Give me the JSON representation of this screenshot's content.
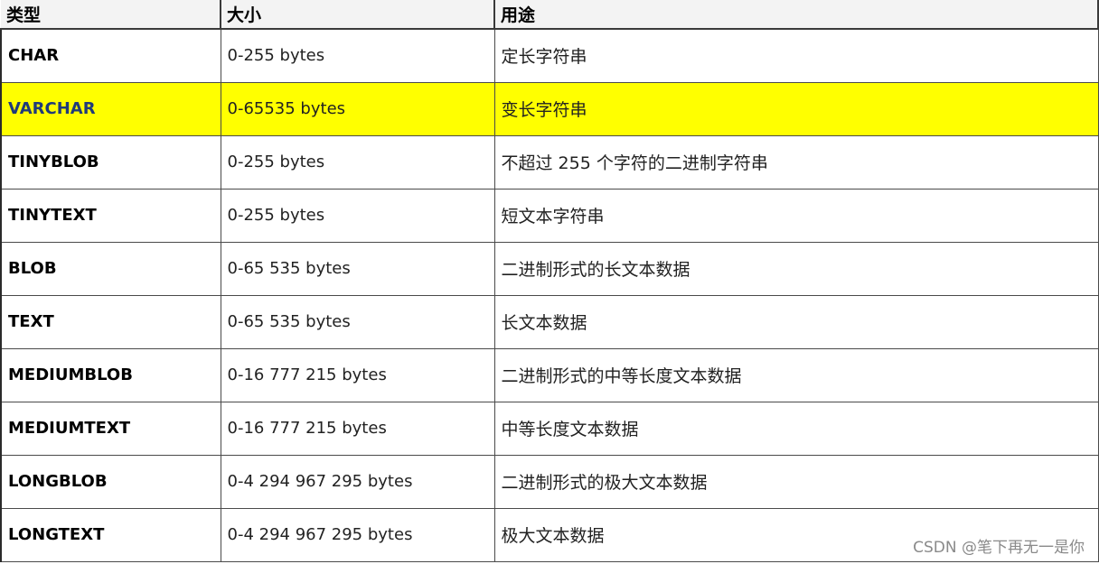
{
  "header": {
    "col_type": "类型",
    "col_size": "大小",
    "col_use": "用途"
  },
  "rows": [
    {
      "type": "CHAR",
      "size": "0-255 bytes",
      "use": "定长字符串"
    },
    {
      "type": "VARCHAR",
      "size": "0-65535 bytes",
      "use": "变长字符串"
    },
    {
      "type": "TINYBLOB",
      "size": "0-255 bytes",
      "use": "不超过 255 个字符的二进制字符串"
    },
    {
      "type": "TINYTEXT",
      "size": "0-255 bytes",
      "use": "短文本字符串"
    },
    {
      "type": "BLOB",
      "size": "0-65 535 bytes",
      "use": "二进制形式的长文本数据"
    },
    {
      "type": "TEXT",
      "size": "0-65 535 bytes",
      "use": "长文本数据"
    },
    {
      "type": "MEDIUMBLOB",
      "size": "0-16 777 215 bytes",
      "use": "二进制形式的中等长度文本数据"
    },
    {
      "type": "MEDIUMTEXT",
      "size": "0-16 777 215 bytes",
      "use": "中等长度文本数据"
    },
    {
      "type": "LONGBLOB",
      "size": "0-4 294 967 295 bytes",
      "use": "二进制形式的极大文本数据"
    },
    {
      "type": "LONGTEXT",
      "size": "0-4 294 967 295 bytes",
      "use": "极大文本数据"
    }
  ],
  "highlight_color": "#ffff00",
  "watermark": "CSDN @笔下再无一是你"
}
